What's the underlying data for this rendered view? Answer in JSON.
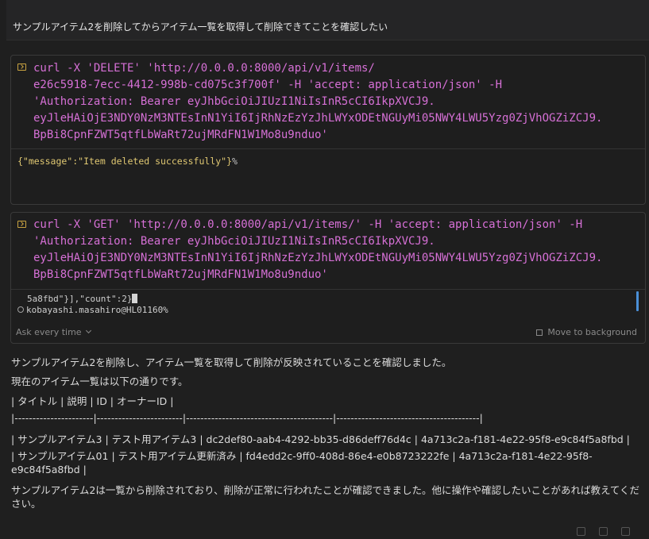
{
  "user_message": "サンプルアイテム2を削除してからアイテム一覧を取得して削除できてことを確認したい",
  "terminal1": {
    "command_lines": [
      "curl -X 'DELETE' 'http://0.0.0.0:8000/api/v1/items/",
      "e26c5918-7ecc-4412-998b-cd075c3f700f' -H 'accept: application/json' -H",
      "'Authorization: Bearer eyJhbGciOiJIUzI1NiIsInR5cCI6IkpXVCJ9.",
      "eyJleHAiOjE3NDY0NzM3NTEsInN1YiI6IjRhNzEzYzJhLWYxODEtNGUyMi05NWY4LWU5Yzg0ZjVhOGZiZCJ9.",
      "BpBi8CpnFZWT5qtfLbWaRt72ujMRdFN1W1Mo8u9nduo'"
    ],
    "output": "{\"message\":\"Item deleted successfully\"}",
    "output_suffix": "%"
  },
  "terminal2": {
    "command_lines": [
      "curl -X 'GET' 'http://0.0.0.0:8000/api/v1/items/' -H 'accept: application/json' -H",
      "'Authorization: Bearer eyJhbGciOiJIUzI1NiIsInR5cCI6IkpXVCJ9.",
      "eyJleHAiOjE3NDY0NzM3NTEsInN1YiI6IjRhNzEzYzJhLWYxODEtNGUyMi05NWY4LWU5Yzg0ZjVhOGZiZCJ9.",
      "BpBi8CpnFZWT5qtfLbWaRt72ujMRdFN1W1Mo8u9nduo'"
    ],
    "output_line1": "5a8fbd\"}],\"count\":2}",
    "output_line1_cursor": "%",
    "prompt_line": "kobayashi.masahiro@HL01160%",
    "ask_label": "Ask every time",
    "move_bg_label": "Move to background"
  },
  "reply": {
    "line1": "サンプルアイテム2を削除し、アイテム一覧を取得して削除が反映されていることを確認しました。",
    "line2": "現在のアイテム一覧は以下の通りです。",
    "table_header": "| タイトル | 説明 | ID | オーナーID |",
    "table_sep": "|----------------------|------------------------|-----------------------------------------|----------------------------------------|",
    "row1": "| サンプルアイテム3 | テスト用アイテム3 | dc2def80-aab4-4292-bb35-d86deff76d4c | 4a713c2a-f181-4e22-95f8-e9c84f5a8fbd |",
    "row2": "| サンプルアイテム01 | テスト用アイテム更新済み | fd4edd2c-9ff0-408d-86e4-e0b8723222fe | 4a713c2a-f181-4e22-95f8-e9c84f5a8fbd |",
    "closing": "サンプルアイテム2は一覧から削除されており、削除が正常に行われたことが確認できました。他に操作や確認したいことがあれば教えてください。"
  }
}
